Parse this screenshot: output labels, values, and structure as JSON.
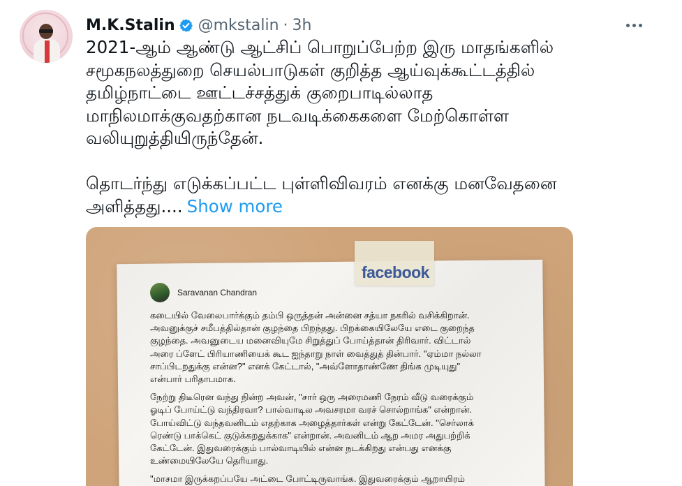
{
  "tweet": {
    "author_name": "M.K.Stalin",
    "handle": "@mkstalin",
    "separator": "·",
    "time": "3h",
    "text_lines": [
      "2021-ஆம் ஆண்டு ஆட்சிப் பொறுப்பேற்ற இரு மாதங்களில்",
      "சமூகநலத்துறை செயல்பாடுகள் குறித்த ஆய்வுக்கூட்டத்தில்",
      "தமிழ்நாட்டை ஊட்டச்சத்துக் குறைபாடில்லாத",
      "மாநிலமாக்குவதற்கான நடவடிக்கைகளை மேற்கொள்ள",
      "வலியுறுத்தியிருந்தேன்.",
      "",
      "தொடர்ந்து எடுக்கப்பட்ட புள்ளிவிவரம் எனக்கு மனவேதனை"
    ],
    "last_line": "அளித்தது....",
    "show_more": "Show more"
  },
  "icons": {
    "verified": "verified-badge-icon",
    "more": "more-options-icon"
  },
  "media": {
    "logo": "facebook",
    "poster_name": "Saravanan Chandran",
    "post_lines": [
      "கடையில் வேலைபார்க்கும் தம்பி ஒருத்தன் அன்னை சத்யா நகரில் வசிக்கிறான்.",
      "அவனுக்குச் சமீபத்தில்தான் குழந்தை பிறந்தது. பிறக்கையிலேயே எடை குறைந்த",
      "குழந்தை. அவனுடைய மனைவியுமே சிறுத்துப் போய்த்தான் திரிவார். விட்டால்",
      "அரை ப்ளேட் பிரியாணியைக் கூட ஐந்தாறு நாள் வைத்துத் தின்பார். \"ஏம்மா நல்லா",
      "சாப்பிடறதுக்கு என்ன?\" எனக் கேட்டால், \"அவ்ளோதாண்ணே திங்க முடியுது\"",
      "என்பார் பரிதாபமாக.",
      "",
      "நேற்று திடீரென வந்து நின்ற அவன், \"சார் ஒரு அரைமணி நேரம் வீடு வரைக்கும்",
      "ஓடிப் போய்ட்டு வந்திரவா? பால்வாடில அவசரமா வரச் சொல்றாங்க\" என்றான்.",
      "போய்விட்டு வந்தவனிடம் எதற்காக அழைத்தார்கள் என்று கேட்டேன். \"செர்லாக்",
      "ரெண்டு பாக்கெட் குடுக்கறதுக்காக\" என்றான். அவனிடம் ஆற அமர அதுபற்றிக்",
      "கேட்டேன். இதுவரைக்கும் பால்வாடியில் என்ன நடக்கிறது என்பது எனக்கு",
      "உண்மையிலேயே தெரியாது.",
      "",
      "\"மாசமா இருக்கறப்பயே அட்டை போட்டிருவாங்க. இதுவரைக்கும் ஆறாயிரம்"
    ]
  },
  "colors": {
    "text": "#0f1419",
    "secondary": "#536471",
    "link": "#1d9bf0",
    "verified": "#1d9bf0",
    "facebook": "#3b5998",
    "media_background": "#cfa47a"
  }
}
